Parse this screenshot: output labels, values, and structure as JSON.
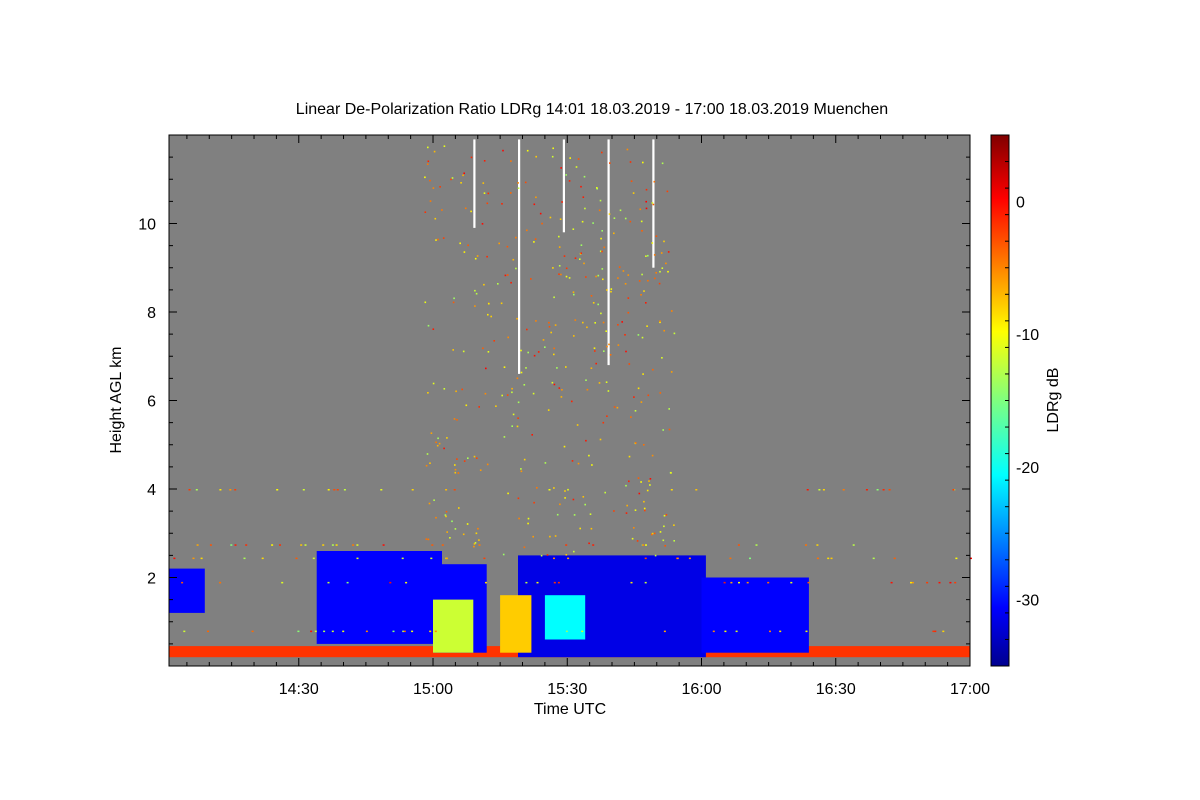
{
  "chart_data": {
    "type": "heatmap",
    "title": "Linear De-Polarization Ratio LDRg   14:01 18.03.2019 - 17:00 18.03.2019 Muenchen",
    "xlabel": "Time UTC",
    "ylabel": "Height AGL km",
    "x_range": [
      "14:01",
      "17:00"
    ],
    "xlim_minutes": [
      841,
      1020
    ],
    "xticks": [
      {
        "label": "14:30",
        "minutes": 870
      },
      {
        "label": "15:00",
        "minutes": 900
      },
      {
        "label": "15:30",
        "minutes": 930
      },
      {
        "label": "16:00",
        "minutes": 960
      },
      {
        "label": "16:30",
        "minutes": 990
      },
      {
        "label": "17:00",
        "minutes": 1020
      }
    ],
    "ylim": [
      0,
      12
    ],
    "yticks": [
      {
        "label": "2",
        "value": 2
      },
      {
        "label": "4",
        "value": 4
      },
      {
        "label": "6",
        "value": 6
      },
      {
        "label": "8",
        "value": 8
      },
      {
        "label": "10",
        "value": 10
      }
    ],
    "colorbar": {
      "label": "LDRg dB",
      "range": [
        -35,
        5
      ],
      "ticks": [
        {
          "label": "0",
          "value": 0
        },
        {
          "label": "-10",
          "value": -10
        },
        {
          "label": "-20",
          "value": -20
        },
        {
          "label": "-30",
          "value": -30
        }
      ],
      "colormap": "jet"
    },
    "background_color": "#808080",
    "features": [
      {
        "name": "surface layer",
        "t_start": 841,
        "t_end": 1020,
        "h_bottom": 0.2,
        "h_top": 0.45,
        "ldr": -2
      },
      {
        "name": "cloud west",
        "t_start": 841,
        "t_end": 849,
        "h_bottom": 1.2,
        "h_top": 2.2,
        "ldr": -30
      },
      {
        "name": "main cloud",
        "t_start": 874,
        "t_end": 902,
        "h_bottom": 0.5,
        "h_top": 2.6,
        "ldr": -30
      },
      {
        "name": "main cloud",
        "t_start": 900,
        "t_end": 912,
        "h_bottom": 0.3,
        "h_top": 2.3,
        "ldr": -30
      },
      {
        "name": "main cloud",
        "t_start": 919,
        "t_end": 961,
        "h_bottom": 0.2,
        "h_top": 2.5,
        "ldr": -31
      },
      {
        "name": "main cloud",
        "t_start": 960,
        "t_end": 984,
        "h_bottom": 0.3,
        "h_top": 2.0,
        "ldr": -30
      },
      {
        "name": "depolarizing region",
        "t_start": 900,
        "t_end": 909,
        "h_bottom": 0.3,
        "h_top": 1.5,
        "ldr": -12
      },
      {
        "name": "depolarizing region",
        "t_start": 915,
        "t_end": 922,
        "h_bottom": 0.3,
        "h_top": 1.6,
        "ldr": -8
      },
      {
        "name": "depolarizing region",
        "t_start": 925,
        "t_end": 934,
        "h_bottom": 0.6,
        "h_top": 1.6,
        "ldr": -20
      },
      {
        "name": "precipitation streak",
        "t_start": 909,
        "t_end": 909.5,
        "h_bottom": 9.9,
        "h_top": 11.9,
        "ldr": "white"
      },
      {
        "name": "precipitation streak",
        "t_start": 919,
        "t_end": 919.5,
        "h_bottom": 6.6,
        "h_top": 11.9,
        "ldr": "white"
      },
      {
        "name": "precipitation streak",
        "t_start": 929,
        "t_end": 929.5,
        "h_bottom": 9.8,
        "h_top": 11.9,
        "ldr": "white"
      },
      {
        "name": "precipitation streak",
        "t_start": 939,
        "t_end": 939.5,
        "h_bottom": 6.8,
        "h_top": 11.9,
        "ldr": "white"
      },
      {
        "name": "precipitation streak",
        "t_start": 949,
        "t_end": 949.5,
        "h_bottom": 9.0,
        "h_top": 11.9,
        "ldr": "white"
      }
    ]
  }
}
